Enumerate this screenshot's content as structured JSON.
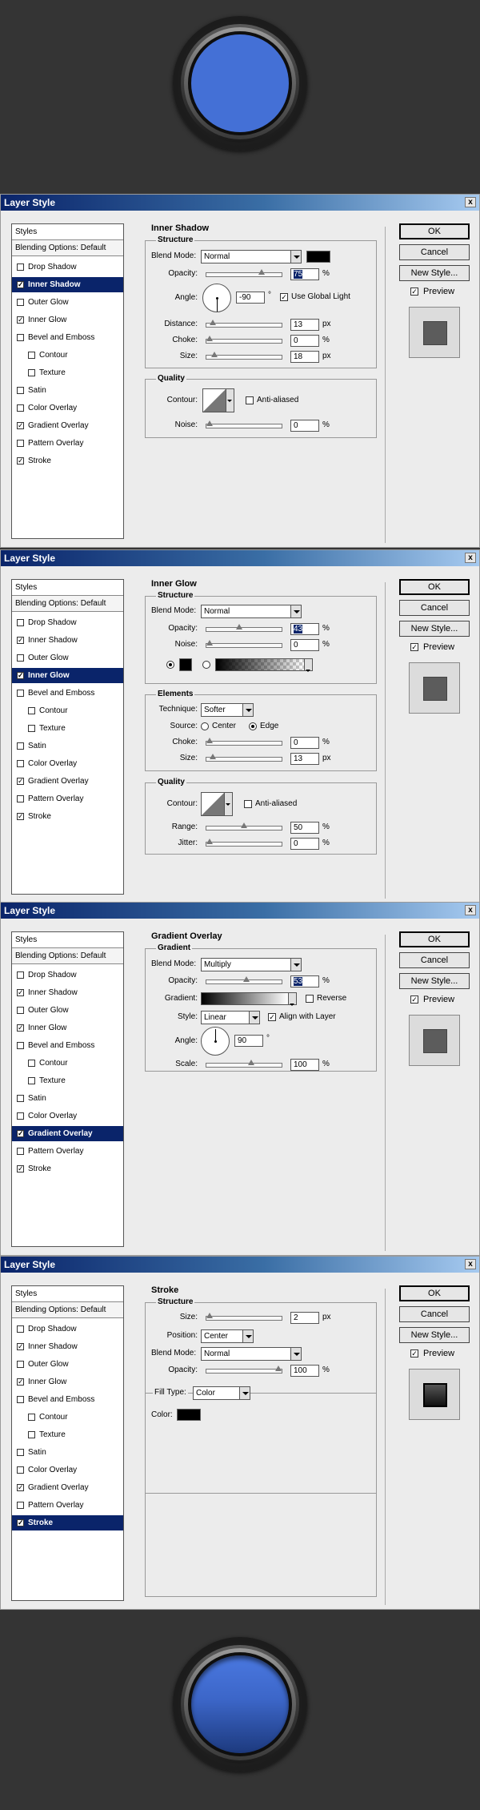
{
  "dialog_title": "Layer Style",
  "close_glyph": "x",
  "styles_header": "Styles",
  "blending_options": "Blending Options: Default",
  "check_glyph": "✓",
  "buttons": {
    "ok": "OK",
    "cancel": "Cancel",
    "new_style": "New Style..."
  },
  "preview_label": "Preview",
  "units": {
    "percent": "%",
    "px": "px",
    "degree": "°"
  },
  "labels": {
    "structure": "Structure",
    "quality": "Quality",
    "elements": "Elements",
    "gradient_section": "Gradient",
    "blend_mode": "Blend Mode:",
    "opacity": "Opacity:",
    "angle": "Angle:",
    "use_global_light": "Use Global Light",
    "distance": "Distance:",
    "choke": "Choke:",
    "size": "Size:",
    "contour": "Contour:",
    "anti_aliased": "Anti-aliased",
    "noise": "Noise:",
    "technique": "Technique:",
    "source": "Source:",
    "center": "Center",
    "edge": "Edge",
    "range": "Range:",
    "jitter": "Jitter:",
    "gradient": "Gradient:",
    "reverse": "Reverse",
    "style": "Style:",
    "align_with_layer": "Align with Layer",
    "scale": "Scale:",
    "position": "Position:",
    "fill_type": "Fill Type:",
    "color": "Color:"
  },
  "style_items": [
    {
      "label": "Drop Shadow",
      "sub": false
    },
    {
      "label": "Inner Shadow",
      "sub": false
    },
    {
      "label": "Outer Glow",
      "sub": false
    },
    {
      "label": "Inner Glow",
      "sub": false
    },
    {
      "label": "Bevel and Emboss",
      "sub": false
    },
    {
      "label": "Contour",
      "sub": true
    },
    {
      "label": "Texture",
      "sub": true
    },
    {
      "label": "Satin",
      "sub": false
    },
    {
      "label": "Color Overlay",
      "sub": false
    },
    {
      "label": "Gradient Overlay",
      "sub": false
    },
    {
      "label": "Pattern Overlay",
      "sub": false
    },
    {
      "label": "Stroke",
      "sub": false
    }
  ],
  "panels": [
    {
      "title": "Inner Shadow",
      "selected_index": 1,
      "checked": [
        false,
        true,
        false,
        true,
        false,
        false,
        false,
        false,
        false,
        true,
        false,
        true
      ],
      "blend_mode": "Normal",
      "color": "#000000",
      "opacity": {
        "value": "75",
        "fraction": 0.75
      },
      "angle": "-90",
      "use_global_light": true,
      "distance": {
        "value": "13",
        "fraction": 0.05
      },
      "choke": {
        "value": "0",
        "fraction": 0.0
      },
      "size": {
        "value": "18",
        "fraction": 0.07
      },
      "anti_aliased": false,
      "noise": {
        "value": "0",
        "fraction": 0.0
      }
    },
    {
      "title": "Inner Glow",
      "selected_index": 3,
      "checked": [
        false,
        true,
        false,
        true,
        false,
        false,
        false,
        false,
        false,
        true,
        false,
        true
      ],
      "blend_mode": "Normal",
      "opacity": {
        "value": "43",
        "fraction": 0.43
      },
      "noise": {
        "value": "0",
        "fraction": 0.0
      },
      "technique": "Softer",
      "source": "edge",
      "choke": {
        "value": "0",
        "fraction": 0.0
      },
      "size": {
        "value": "13",
        "fraction": 0.05
      },
      "anti_aliased": false,
      "range": {
        "value": "50",
        "fraction": 0.5
      },
      "jitter": {
        "value": "0",
        "fraction": 0.0
      }
    },
    {
      "title": "Gradient Overlay",
      "selected_index": 9,
      "checked": [
        false,
        true,
        false,
        true,
        false,
        false,
        false,
        false,
        false,
        true,
        false,
        true
      ],
      "blend_mode": "Multiply",
      "opacity": {
        "value": "53",
        "fraction": 0.53
      },
      "reverse": false,
      "style": "Linear",
      "align_with_layer": true,
      "angle": "90",
      "scale": {
        "value": "100",
        "fraction": 0.6
      }
    },
    {
      "title": "Stroke",
      "selected_index": 11,
      "checked": [
        false,
        true,
        false,
        true,
        false,
        false,
        false,
        false,
        false,
        true,
        false,
        true
      ],
      "size": {
        "value": "2",
        "fraction": 0.0
      },
      "position": "Center",
      "blend_mode": "Normal",
      "opacity": {
        "value": "100",
        "fraction": 1.0
      },
      "fill_type": "Color",
      "color": "#000000"
    }
  ],
  "colors": {
    "title_bar": "#0a246a",
    "button_face": "#4470d6",
    "selection": "#0a246a"
  }
}
